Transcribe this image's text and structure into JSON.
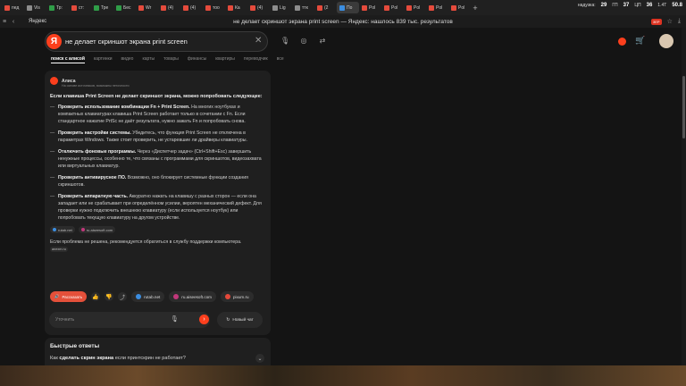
{
  "browser": {
    "tabs": [
      {
        "label": "пед",
        "color": "#e54b3c"
      },
      {
        "label": "Vis",
        "color": "#8d8d8d"
      },
      {
        "label": "Тр:",
        "color": "#2f9d48"
      },
      {
        "label": "ст:",
        "color": "#e54b3c"
      },
      {
        "label": "Тре",
        "color": "#2f9d48"
      },
      {
        "label": "Бес",
        "color": "#2f9d48"
      },
      {
        "label": "Wr",
        "color": "#e54b3c"
      },
      {
        "label": "(4)",
        "color": "#e54b3c"
      },
      {
        "label": "(4)",
        "color": "#e54b3c"
      },
      {
        "label": "тоо",
        "color": "#e54b3c"
      },
      {
        "label": "Ка",
        "color": "#e54b3c"
      },
      {
        "label": "(4)",
        "color": "#e54b3c"
      },
      {
        "label": "Lig",
        "color": "#8d8d8d"
      },
      {
        "label": "ттк",
        "color": "#8d8d8d"
      },
      {
        "label": "(2",
        "color": "#e54b3c"
      },
      {
        "label": "По",
        "color": "#3b8de0"
      },
      {
        "label": "Pol",
        "color": "#e54b3c"
      },
      {
        "label": "Pol",
        "color": "#e54b3c"
      },
      {
        "label": "Pol",
        "color": "#e54b3c"
      },
      {
        "label": "Pol",
        "color": "#e54b3c"
      },
      {
        "label": "Pol",
        "color": "#e54b3c"
      }
    ],
    "sysinfo": {
      "disk_label": "надузка:",
      "disk_val": "29",
      "gpu_label": "ГП",
      "gpu_val": "37",
      "cpu_label": "ЦП",
      "cpu_val": "36",
      "net_label": "1.4Т",
      "net_val": "50.8"
    },
    "site": "Яндекс",
    "page_title": "не делает скриншот экрана print screen — Яндекс: нашлось 839 тыс. результатов",
    "badge": "ЗЕР"
  },
  "search": {
    "logo": "Я",
    "query": "не делает скриншот экрана print screen",
    "tabs": [
      "поиск с алисой",
      "картинки",
      "видео",
      "карты",
      "товары",
      "финансы",
      "квартиры",
      "переводчик",
      "все"
    ]
  },
  "answer": {
    "author": "Алиса",
    "subtitle": "На основе источников, возможны неточности",
    "intro": "Если клавиша Print Screen не делает скриншот экрана, можно попробовать следующее:",
    "items": [
      {
        "head": "Проверить использование комбинации Fn + Print Screen.",
        "text": " На многих ноутбуках и компактных клавиатурах клавиша Print Screen работает только в сочетании с Fn. Если стандартное нажатие PrtSc не даёт результата, нужно зажать Fn и попробовать снова."
      },
      {
        "head": "Проверить настройки системы.",
        "text": " Убедитесь, что функция Print Screen не отключена в параметрах Windows. Также стоит проверить, не устаревшие ли драйверы клавиатуры."
      },
      {
        "head": "Отключить фоновые программы.",
        "text": " Через «Диспетчер задач» (Ctrl+Shift+Esc) завершить ненужные процессы, особенно те, что связаны с программами для скриншотов, видеозахвата или виртуальных клавиатур."
      },
      {
        "head": "Проверить антивирусное ПО.",
        "text": " Возможно, оно блокирует системные функции создания скриншотов."
      },
      {
        "head": "Проверить аппаратную часть.",
        "text": " Аккуратно нажать на клавишу с разных сторон — если она западает или не срабатывает при определённом усилии, вероятен механический дефект. Для проверки нужно подключить внешнюю клавиатуру (если используется ноутбук) или попробовать текущую клавиатуру на другом устройстве."
      }
    ],
    "sources": [
      {
        "label": "rutab.net",
        "color": "#3b8de0"
      },
      {
        "label": "ru.aiseesoft.com",
        "color": "#c0377a"
      }
    ],
    "footer": "Если проблема не решена, рекомендуется обратиться в службу поддержки компьютера.",
    "footer_source": "anexm.ru",
    "tell_label": "Рассказать",
    "site_chips": [
      {
        "label": "rutab.net",
        "color": "#3b8de0"
      },
      {
        "label": "ru.aiseesoft.com",
        "color": "#c0377a"
      },
      {
        "label": "pixum.ru",
        "color": "#e5483a"
      }
    ],
    "ask_placeholder": "Уточнить",
    "new_chat": "Новый чат"
  },
  "quick": {
    "title": "Быстрые ответы",
    "question_prefix": "Как ",
    "question_bold": "сделать скрин экрана",
    "question_suffix": " если принтскрин не работает?"
  }
}
